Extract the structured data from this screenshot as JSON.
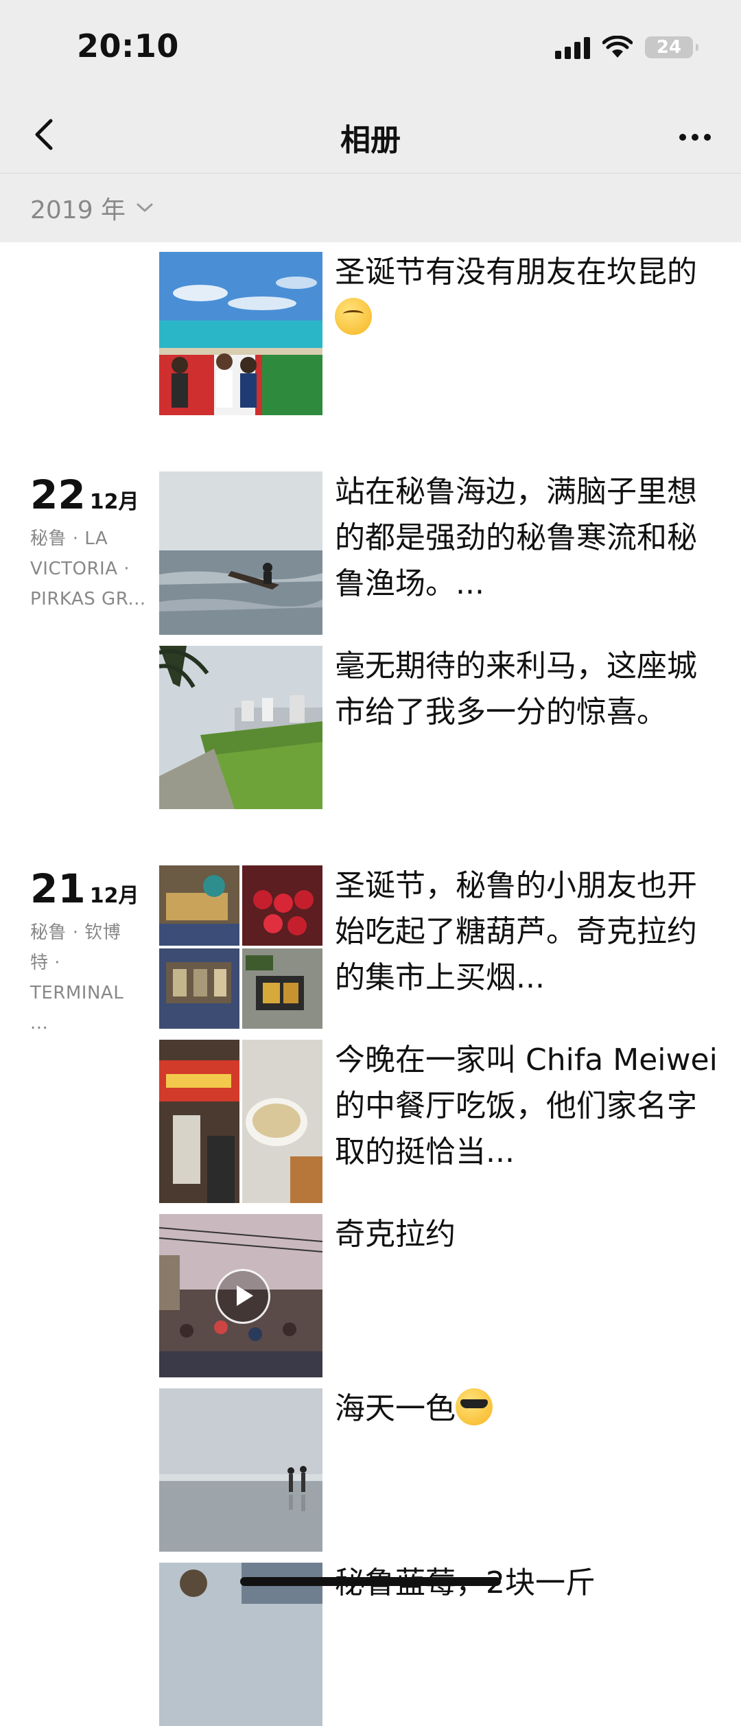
{
  "status_bar": {
    "time": "20:10",
    "battery": "24"
  },
  "nav": {
    "title": "相册"
  },
  "year_filter": {
    "label": "2019 年"
  },
  "entries": [
    {
      "posts": [
        {
          "text": "圣诞节有没有朋友在坎昆的",
          "emoji": "wink-emoji"
        }
      ]
    },
    {
      "day": "22",
      "month": "12月",
      "location": [
        "秘鲁 · LA",
        "VICTORIA ·",
        "PIRKAS GR..."
      ],
      "posts": [
        {
          "text": "站在秘鲁海边，满脑子里想的都是强劲的秘鲁寒流和秘鲁渔场。..."
        },
        {
          "text": "毫无期待的来利马，这座城市给了我多一分的惊喜。"
        }
      ]
    },
    {
      "day": "21",
      "month": "12月",
      "location": [
        "秘鲁 · 钦博",
        "特 ·",
        "TERMINAL ..."
      ],
      "posts": [
        {
          "text": "圣诞节，秘鲁的小朋友也开始吃起了糖葫芦。奇克拉约的集市上买烟..."
        },
        {
          "text": "今晚在一家叫 Chifa Meiwei 的中餐厅吃饭，他们家名字取的挺恰当..."
        },
        {
          "text": "奇克拉约"
        },
        {
          "text": "海天一色",
          "emoji": "sunglasses-emoji"
        },
        {
          "text": "秘鲁蓝莓，2块一斤"
        }
      ]
    }
  ]
}
